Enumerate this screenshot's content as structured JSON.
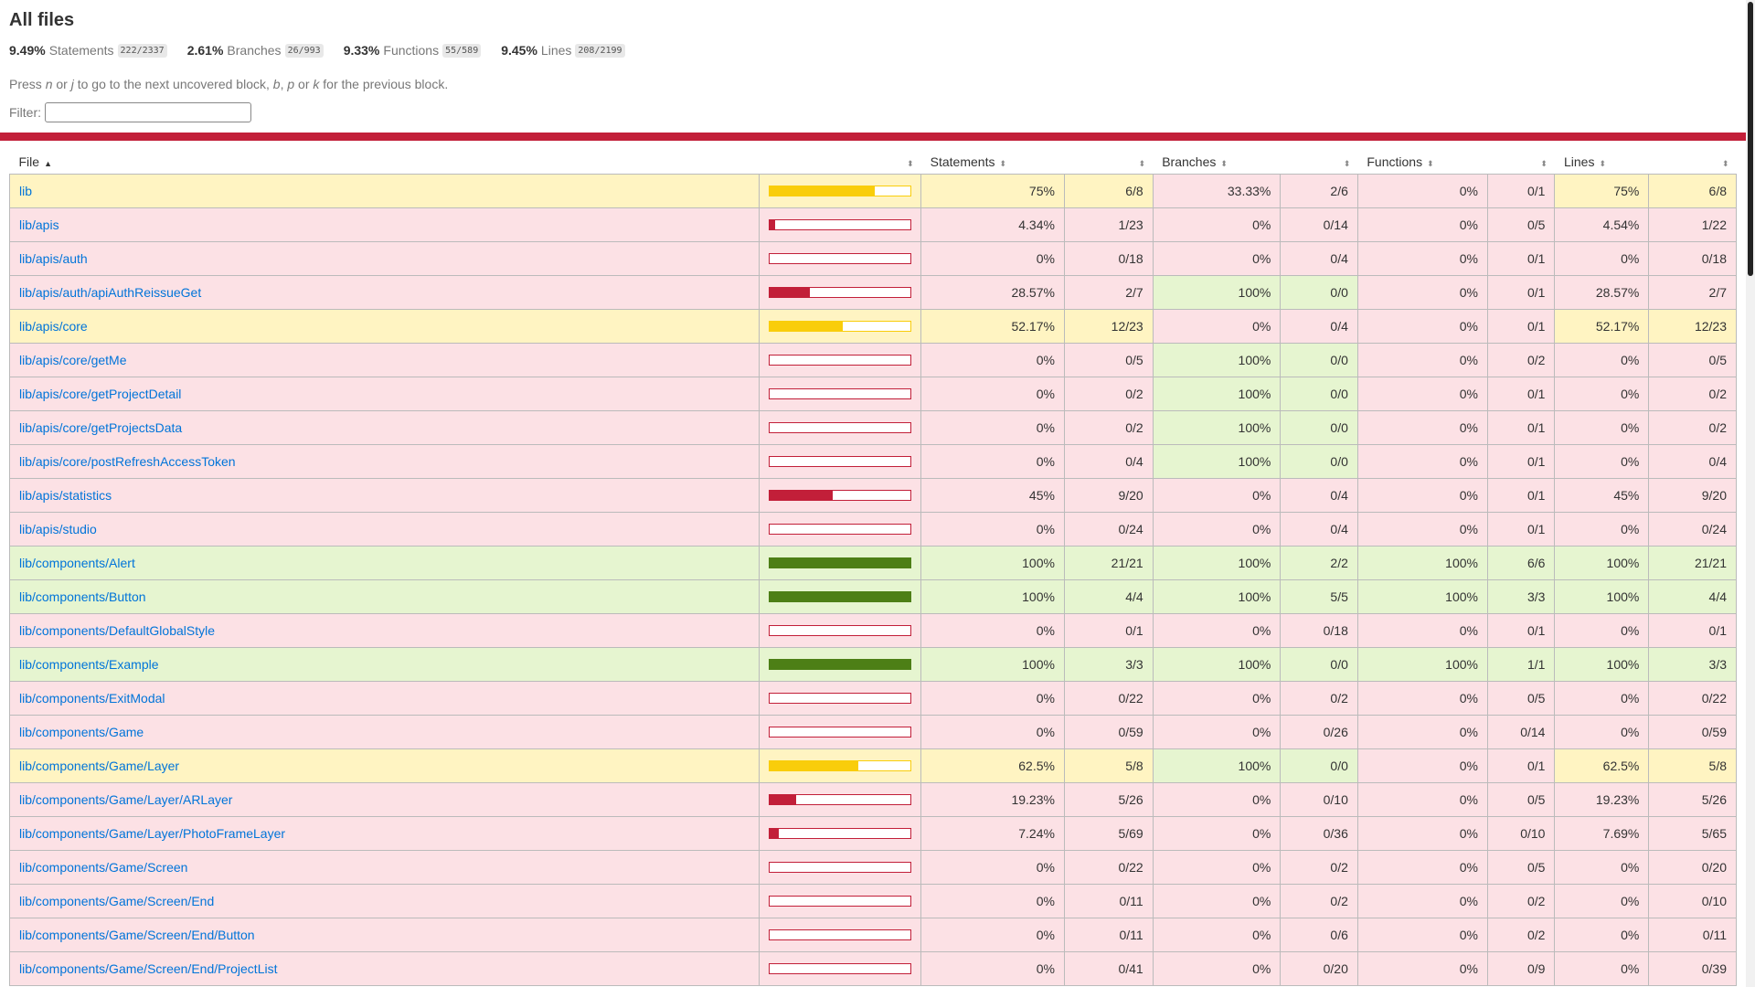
{
  "title": "All files",
  "summary": [
    {
      "pct": "9.49%",
      "label": "Statements",
      "fraction": "222/2337"
    },
    {
      "pct": "2.61%",
      "label": "Branches",
      "fraction": "26/993"
    },
    {
      "pct": "9.33%",
      "label": "Functions",
      "fraction": "55/589"
    },
    {
      "pct": "9.45%",
      "label": "Lines",
      "fraction": "208/2199"
    }
  ],
  "hint": {
    "pre": "Press ",
    "k1": "n",
    "or1": " or ",
    "k2": "j",
    "mid": " to go to the next uncovered block, ",
    "k3": "b",
    "comma": ", ",
    "k4": "p",
    "or2": " or ",
    "k5": "k",
    "post": " for the previous block."
  },
  "filter": {
    "label": "Filter:",
    "value": ""
  },
  "columns": {
    "file": "File",
    "statements": "Statements",
    "branches": "Branches",
    "functions": "Functions",
    "lines": "Lines"
  },
  "colors": {
    "low": "#C21F39",
    "medium": "#f9cd0b",
    "high": "#4d7f16",
    "link": "#0074D9"
  },
  "rows": [
    {
      "file": "lib",
      "level": "medium",
      "bar": 0.75,
      "s": [
        "75%",
        "6/8",
        "medium"
      ],
      "b": [
        "33.33%",
        "2/6",
        "low"
      ],
      "f": [
        "0%",
        "0/1",
        "low"
      ],
      "l": [
        "75%",
        "6/8",
        "medium"
      ]
    },
    {
      "file": "lib/apis",
      "level": "low",
      "bar": 0.0434,
      "s": [
        "4.34%",
        "1/23",
        "low"
      ],
      "b": [
        "0%",
        "0/14",
        "low"
      ],
      "f": [
        "0%",
        "0/5",
        "low"
      ],
      "l": [
        "4.54%",
        "1/22",
        "low"
      ]
    },
    {
      "file": "lib/apis/auth",
      "level": "low",
      "bar": 0,
      "s": [
        "0%",
        "0/18",
        "low"
      ],
      "b": [
        "0%",
        "0/4",
        "low"
      ],
      "f": [
        "0%",
        "0/1",
        "low"
      ],
      "l": [
        "0%",
        "0/18",
        "low"
      ]
    },
    {
      "file": "lib/apis/auth/apiAuthReissueGet",
      "level": "low",
      "bar": 0.2857,
      "s": [
        "28.57%",
        "2/7",
        "low"
      ],
      "b": [
        "100%",
        "0/0",
        "high"
      ],
      "f": [
        "0%",
        "0/1",
        "low"
      ],
      "l": [
        "28.57%",
        "2/7",
        "low"
      ]
    },
    {
      "file": "lib/apis/core",
      "level": "medium",
      "bar": 0.5217,
      "s": [
        "52.17%",
        "12/23",
        "medium"
      ],
      "b": [
        "0%",
        "0/4",
        "low"
      ],
      "f": [
        "0%",
        "0/1",
        "low"
      ],
      "l": [
        "52.17%",
        "12/23",
        "medium"
      ]
    },
    {
      "file": "lib/apis/core/getMe",
      "level": "low",
      "bar": 0,
      "s": [
        "0%",
        "0/5",
        "low"
      ],
      "b": [
        "100%",
        "0/0",
        "high"
      ],
      "f": [
        "0%",
        "0/2",
        "low"
      ],
      "l": [
        "0%",
        "0/5",
        "low"
      ]
    },
    {
      "file": "lib/apis/core/getProjectDetail",
      "level": "low",
      "bar": 0,
      "s": [
        "0%",
        "0/2",
        "low"
      ],
      "b": [
        "100%",
        "0/0",
        "high"
      ],
      "f": [
        "0%",
        "0/1",
        "low"
      ],
      "l": [
        "0%",
        "0/2",
        "low"
      ]
    },
    {
      "file": "lib/apis/core/getProjectsData",
      "level": "low",
      "bar": 0,
      "s": [
        "0%",
        "0/2",
        "low"
      ],
      "b": [
        "100%",
        "0/0",
        "high"
      ],
      "f": [
        "0%",
        "0/1",
        "low"
      ],
      "l": [
        "0%",
        "0/2",
        "low"
      ]
    },
    {
      "file": "lib/apis/core/postRefreshAccessToken",
      "level": "low",
      "bar": 0,
      "s": [
        "0%",
        "0/4",
        "low"
      ],
      "b": [
        "100%",
        "0/0",
        "high"
      ],
      "f": [
        "0%",
        "0/1",
        "low"
      ],
      "l": [
        "0%",
        "0/4",
        "low"
      ]
    },
    {
      "file": "lib/apis/statistics",
      "level": "low",
      "bar": 0.45,
      "s": [
        "45%",
        "9/20",
        "low"
      ],
      "b": [
        "0%",
        "0/4",
        "low"
      ],
      "f": [
        "0%",
        "0/1",
        "low"
      ],
      "l": [
        "45%",
        "9/20",
        "low"
      ]
    },
    {
      "file": "lib/apis/studio",
      "level": "low",
      "bar": 0,
      "s": [
        "0%",
        "0/24",
        "low"
      ],
      "b": [
        "0%",
        "0/4",
        "low"
      ],
      "f": [
        "0%",
        "0/1",
        "low"
      ],
      "l": [
        "0%",
        "0/24",
        "low"
      ]
    },
    {
      "file": "lib/components/Alert",
      "level": "high",
      "bar": 1,
      "s": [
        "100%",
        "21/21",
        "high"
      ],
      "b": [
        "100%",
        "2/2",
        "high"
      ],
      "f": [
        "100%",
        "6/6",
        "high"
      ],
      "l": [
        "100%",
        "21/21",
        "high"
      ]
    },
    {
      "file": "lib/components/Button",
      "level": "high",
      "bar": 1,
      "s": [
        "100%",
        "4/4",
        "high"
      ],
      "b": [
        "100%",
        "5/5",
        "high"
      ],
      "f": [
        "100%",
        "3/3",
        "high"
      ],
      "l": [
        "100%",
        "4/4",
        "high"
      ]
    },
    {
      "file": "lib/components/DefaultGlobalStyle",
      "level": "low",
      "bar": 0,
      "s": [
        "0%",
        "0/1",
        "low"
      ],
      "b": [
        "0%",
        "0/18",
        "low"
      ],
      "f": [
        "0%",
        "0/1",
        "low"
      ],
      "l": [
        "0%",
        "0/1",
        "low"
      ]
    },
    {
      "file": "lib/components/Example",
      "level": "high",
      "bar": 1,
      "s": [
        "100%",
        "3/3",
        "high"
      ],
      "b": [
        "100%",
        "0/0",
        "high"
      ],
      "f": [
        "100%",
        "1/1",
        "high"
      ],
      "l": [
        "100%",
        "3/3",
        "high"
      ]
    },
    {
      "file": "lib/components/ExitModal",
      "level": "low",
      "bar": 0,
      "s": [
        "0%",
        "0/22",
        "low"
      ],
      "b": [
        "0%",
        "0/2",
        "low"
      ],
      "f": [
        "0%",
        "0/5",
        "low"
      ],
      "l": [
        "0%",
        "0/22",
        "low"
      ]
    },
    {
      "file": "lib/components/Game",
      "level": "low",
      "bar": 0,
      "s": [
        "0%",
        "0/59",
        "low"
      ],
      "b": [
        "0%",
        "0/26",
        "low"
      ],
      "f": [
        "0%",
        "0/14",
        "low"
      ],
      "l": [
        "0%",
        "0/59",
        "low"
      ]
    },
    {
      "file": "lib/components/Game/Layer",
      "level": "medium",
      "bar": 0.625,
      "s": [
        "62.5%",
        "5/8",
        "medium"
      ],
      "b": [
        "100%",
        "0/0",
        "high"
      ],
      "f": [
        "0%",
        "0/1",
        "low"
      ],
      "l": [
        "62.5%",
        "5/8",
        "medium"
      ]
    },
    {
      "file": "lib/components/Game/Layer/ARLayer",
      "level": "low",
      "bar": 0.1923,
      "s": [
        "19.23%",
        "5/26",
        "low"
      ],
      "b": [
        "0%",
        "0/10",
        "low"
      ],
      "f": [
        "0%",
        "0/5",
        "low"
      ],
      "l": [
        "19.23%",
        "5/26",
        "low"
      ]
    },
    {
      "file": "lib/components/Game/Layer/PhotoFrameLayer",
      "level": "low",
      "bar": 0.0724,
      "s": [
        "7.24%",
        "5/69",
        "low"
      ],
      "b": [
        "0%",
        "0/36",
        "low"
      ],
      "f": [
        "0%",
        "0/10",
        "low"
      ],
      "l": [
        "7.69%",
        "5/65",
        "low"
      ]
    },
    {
      "file": "lib/components/Game/Screen",
      "level": "low",
      "bar": 0,
      "s": [
        "0%",
        "0/22",
        "low"
      ],
      "b": [
        "0%",
        "0/2",
        "low"
      ],
      "f": [
        "0%",
        "0/5",
        "low"
      ],
      "l": [
        "0%",
        "0/20",
        "low"
      ]
    },
    {
      "file": "lib/components/Game/Screen/End",
      "level": "low",
      "bar": 0,
      "s": [
        "0%",
        "0/11",
        "low"
      ],
      "b": [
        "0%",
        "0/2",
        "low"
      ],
      "f": [
        "0%",
        "0/2",
        "low"
      ],
      "l": [
        "0%",
        "0/10",
        "low"
      ]
    },
    {
      "file": "lib/components/Game/Screen/End/Button",
      "level": "low",
      "bar": 0,
      "s": [
        "0%",
        "0/11",
        "low"
      ],
      "b": [
        "0%",
        "0/6",
        "low"
      ],
      "f": [
        "0%",
        "0/2",
        "low"
      ],
      "l": [
        "0%",
        "0/11",
        "low"
      ]
    },
    {
      "file": "lib/components/Game/Screen/End/ProjectList",
      "level": "low",
      "bar": 0,
      "s": [
        "0%",
        "0/41",
        "low"
      ],
      "b": [
        "0%",
        "0/20",
        "low"
      ],
      "f": [
        "0%",
        "0/9",
        "low"
      ],
      "l": [
        "0%",
        "0/39",
        "low"
      ]
    }
  ]
}
